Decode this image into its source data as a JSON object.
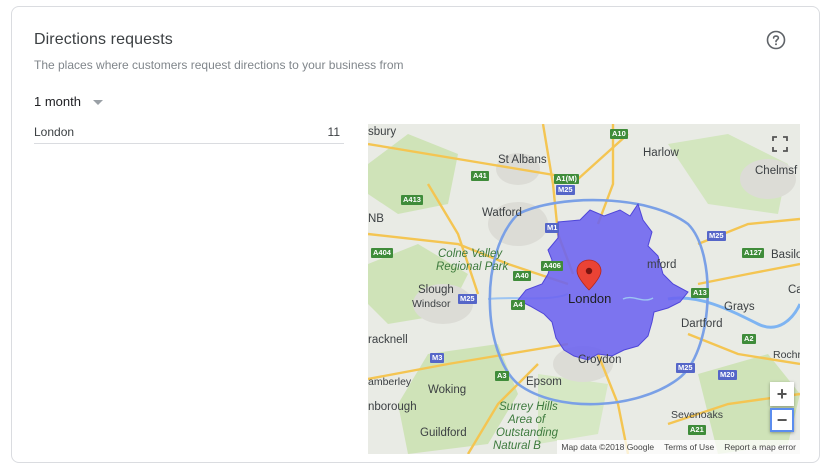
{
  "card": {
    "title": "Directions requests",
    "subtitle": "The places where customers request directions to your business from",
    "help_icon": "help-circle-icon"
  },
  "period": {
    "selected": "1 month"
  },
  "locations": [
    {
      "name": "London",
      "count": "11"
    }
  ],
  "map": {
    "labels": {
      "st_albans": "St Albans",
      "harlow": "Harlow",
      "chelmsford": "Chelmsf",
      "watford": "Watford",
      "colne_valley": "Colne Valley",
      "regional_park": "Regional Park",
      "slough": "Slough",
      "windsor": "Windsor",
      "london": "London",
      "romford": "mford",
      "grays": "Grays",
      "dartford": "Dartford",
      "basildon": "Basilo",
      "bracknell": "racknell",
      "croydon": "Croydon",
      "camberley": "amberley",
      "woking": "Woking",
      "epsom": "Epsom",
      "farnborough": "nborough",
      "surrey_hills": "Surrey Hills",
      "area_of": "Area of",
      "outstanding": "Outstanding",
      "natural_b": "Natural B",
      "guildford": "Guildford",
      "sevenoaks": "Sevenoaks",
      "rochester": "Rochr",
      "aylesbury": "sbury",
      "anb": "NB",
      "ca": "Ca"
    },
    "shields": {
      "a10": "A10",
      "a41": "A41",
      "a1m": "A1(M)",
      "m25a": "M25",
      "a413": "A413",
      "m1": "M1",
      "m25b": "M25",
      "a127": "A127",
      "a404": "A404",
      "a406": "A406",
      "a40": "A40",
      "m25c": "M25",
      "a4": "A4",
      "a13": "A13",
      "a2": "A2",
      "m3": "M3",
      "m25d": "M25",
      "m20": "M20",
      "a3": "A3",
      "a21": "A21"
    },
    "zoom_in": "+",
    "zoom_out": "−",
    "attribution": {
      "map_data": "Map data ©2018 Google",
      "terms": "Terms of Use",
      "report": "Report a map error"
    },
    "colors": {
      "region_fill": "#6c63f0",
      "marker": "#ea4335",
      "land": "#e8eae4",
      "park": "#c9dfb2",
      "road_major": "#f6c453",
      "water": "#7eb4f2"
    }
  }
}
